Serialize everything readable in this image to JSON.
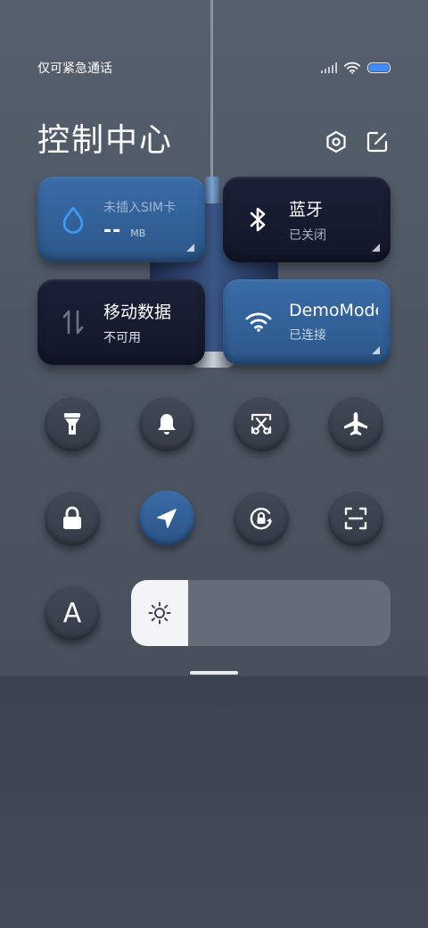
{
  "status_bar": {
    "carrier": "仅可紧急通话",
    "icons": [
      "signal-icon",
      "wifi-icon",
      "battery-icon"
    ],
    "battery_color": "#3f8cff"
  },
  "header": {
    "title": "控制中心",
    "buttons": [
      "settings-icon",
      "edit-icon"
    ]
  },
  "tiles": {
    "data_usage": {
      "label": "未插入SIM卡",
      "value": "--",
      "unit": "MB",
      "icon": "water-drop-icon",
      "state": "active"
    },
    "bluetooth": {
      "title": "蓝牙",
      "status": "已关闭",
      "icon": "bluetooth-icon",
      "state": "off"
    },
    "mobile_data": {
      "title": "移动数据",
      "status": "不可用",
      "icon": "data-arrows-icon",
      "state": "off"
    },
    "wifi": {
      "title": "DemoMode",
      "status": "已连接",
      "icon": "wifi-icon",
      "state": "on"
    }
  },
  "toggles": [
    {
      "name": "flashlight",
      "icon": "flashlight-icon",
      "on": false
    },
    {
      "name": "ringer",
      "icon": "bell-icon",
      "on": false
    },
    {
      "name": "screenshot",
      "icon": "scissors-icon",
      "on": false
    },
    {
      "name": "airplane-mode",
      "icon": "airplane-icon",
      "on": false
    },
    {
      "name": "lock-screen",
      "icon": "lock-icon",
      "on": false
    },
    {
      "name": "location",
      "icon": "location-arrow-icon",
      "on": true
    },
    {
      "name": "rotation-lock",
      "icon": "rotation-lock-icon",
      "on": false
    },
    {
      "name": "scanner",
      "icon": "scan-icon",
      "on": false
    }
  ],
  "brightness": {
    "auto_label": "A",
    "level": 0.22,
    "icon": "sun-icon"
  },
  "colors": {
    "accent_tile": "#2f5e97",
    "dark_tile": "#161a30"
  }
}
